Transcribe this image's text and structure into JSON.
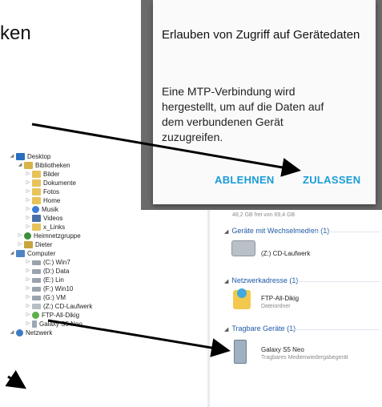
{
  "heading_fragment": "ken",
  "dialog": {
    "title": "Erlauben von Zugriff auf Gerätedaten",
    "body": "Eine MTP-Verbindung wird hergestellt, um auf die Daten auf dem verbundenen Gerät zuzugreifen.",
    "deny_label": "ABLEHNEN",
    "allow_label": "ZULASSEN",
    "accent_color": "#1a9bd7"
  },
  "tree": {
    "items": [
      {
        "label": "Desktop",
        "icon": "desktop-icon"
      },
      {
        "label": "Bibliotheken",
        "icon": "libraries-icon"
      },
      {
        "label": "Bilder",
        "icon": "pictures-icon"
      },
      {
        "label": "Dokumente",
        "icon": "documents-icon"
      },
      {
        "label": "Fotos",
        "icon": "folder-icon"
      },
      {
        "label": "Home",
        "icon": "folder-icon"
      },
      {
        "label": "Musik",
        "icon": "music-icon"
      },
      {
        "label": "Videos",
        "icon": "videos-icon"
      },
      {
        "label": "x_Links",
        "icon": "folder-icon"
      },
      {
        "label": "Heimnetzgruppe",
        "icon": "homegroup-icon"
      },
      {
        "label": "Dieter",
        "icon": "user-folder-icon"
      },
      {
        "label": "Computer",
        "icon": "computer-icon"
      },
      {
        "label": "(C:) Win7",
        "icon": "drive-icon"
      },
      {
        "label": "(D:) Data",
        "icon": "drive-icon"
      },
      {
        "label": "(E:) Lin",
        "icon": "drive-icon"
      },
      {
        "label": "(F:) Win10",
        "icon": "drive-icon"
      },
      {
        "label": "(G:) VM",
        "icon": "drive-icon"
      },
      {
        "label": "(Z:) CD-Laufwerk",
        "icon": "cd-drive-icon"
      },
      {
        "label": "FTP-All-Dikig",
        "icon": "ftp-icon"
      },
      {
        "label": "Galaxy S5 Neo",
        "icon": "phone-icon"
      },
      {
        "label": "Netzwerk",
        "icon": "network-icon"
      }
    ]
  },
  "content": {
    "partial_size": "48,2 GB frei von 69,4 GB",
    "removable_section": "Geräte mit Wechselmedien (1)",
    "cd_drive": "(Z:) CD-Laufwerk",
    "network_section": "Netzwerkadresse (1)",
    "ftp_name": "FTP-All-Dikig",
    "ftp_type": "Dateiordner",
    "portable_section": "Tragbare Geräte (1)",
    "phone_name": "Galaxy S5 Neo",
    "phone_type": "Tragbares Medienwiedergabegerät"
  }
}
